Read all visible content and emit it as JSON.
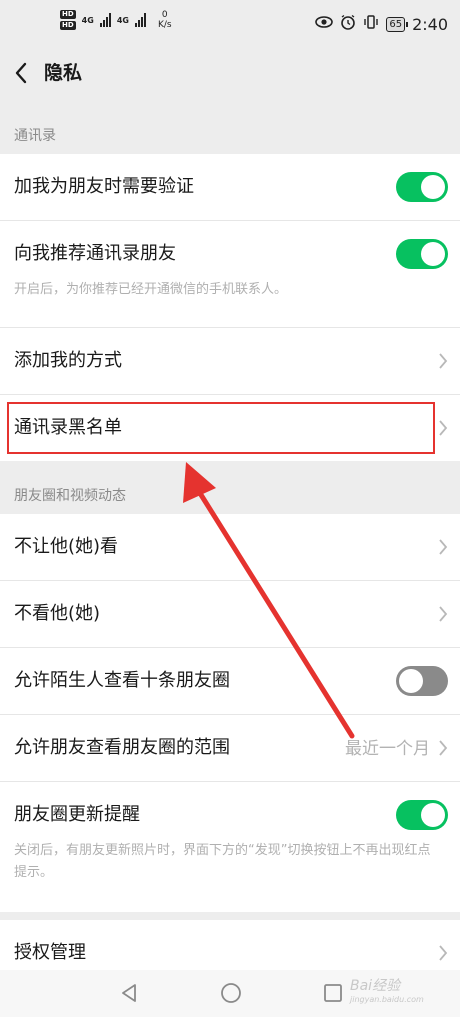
{
  "status_bar": {
    "network_1": "4G",
    "network_2": "4G",
    "speed_value": "0",
    "speed_unit": "K/s",
    "battery": "65",
    "time": "2:40",
    "icons": [
      "hd-icon",
      "signal-icon",
      "eye-icon",
      "alarm-icon",
      "vibrate-icon",
      "battery-icon"
    ]
  },
  "header": {
    "title": "隐私"
  },
  "sections": {
    "contacts": "通讯录",
    "moments": "朋友圈和视频动态"
  },
  "contacts": {
    "verify_label": "加我为朋友时需要验证",
    "verify_on": true,
    "recommend_label": "向我推荐通讯录朋友",
    "recommend_desc": "开启后，为你推荐已经开通微信的手机联系人。",
    "recommend_on": true,
    "add_methods_label": "添加我的方式",
    "blacklist_label": "通讯录黑名单"
  },
  "moments": {
    "hide_from_label": "不让他(她)看",
    "dont_see_label": "不看他(她)",
    "stranger_label": "允许陌生人查看十条朋友圈",
    "stranger_on": false,
    "range_label": "允许朋友查看朋友圈的范围",
    "range_value": "最近一个月",
    "reminder_label": "朋友圈更新提醒",
    "reminder_desc": "关闭后，有朋友更新照片时，界面下方的“发现”切换按钮上不再出现红点提示。",
    "reminder_on": true
  },
  "more": {
    "auth_label": "授权管理"
  },
  "watermark": {
    "text": "Bai经验",
    "sub": "jingyan.baidu.com"
  },
  "colors": {
    "toggle_on": "#07c160",
    "toggle_off": "#8a8a8a",
    "highlight": "#e5332f",
    "background": "#ededed"
  }
}
